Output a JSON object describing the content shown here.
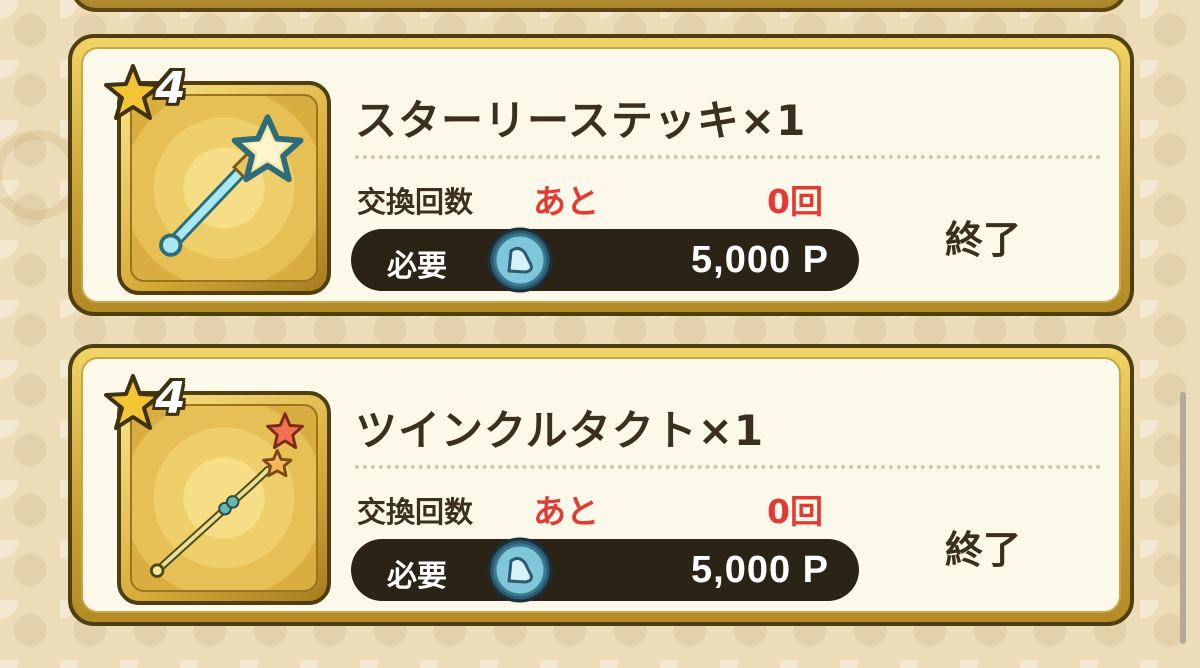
{
  "items": [
    {
      "rarity": "4",
      "name": "スターリーステッキ×1",
      "exchange_label": "交換回数",
      "remaining_label": "あと",
      "remaining_count": "0回",
      "cost_label": "必要",
      "cost": "5,000 P",
      "status": "終了",
      "icon": "starry-wand-icon"
    },
    {
      "rarity": "4",
      "name": "ツインクルタクト×1",
      "exchange_label": "交換回数",
      "remaining_label": "あと",
      "remaining_count": "0回",
      "cost_label": "必要",
      "cost": "5,000 P",
      "status": "終了",
      "icon": "twinkle-baton-icon"
    }
  ],
  "colors": {
    "accent_red": "#e23b36",
    "frame_gold": "#cda236",
    "text_dark": "#3b3020",
    "pill_dark": "#2b2416"
  }
}
